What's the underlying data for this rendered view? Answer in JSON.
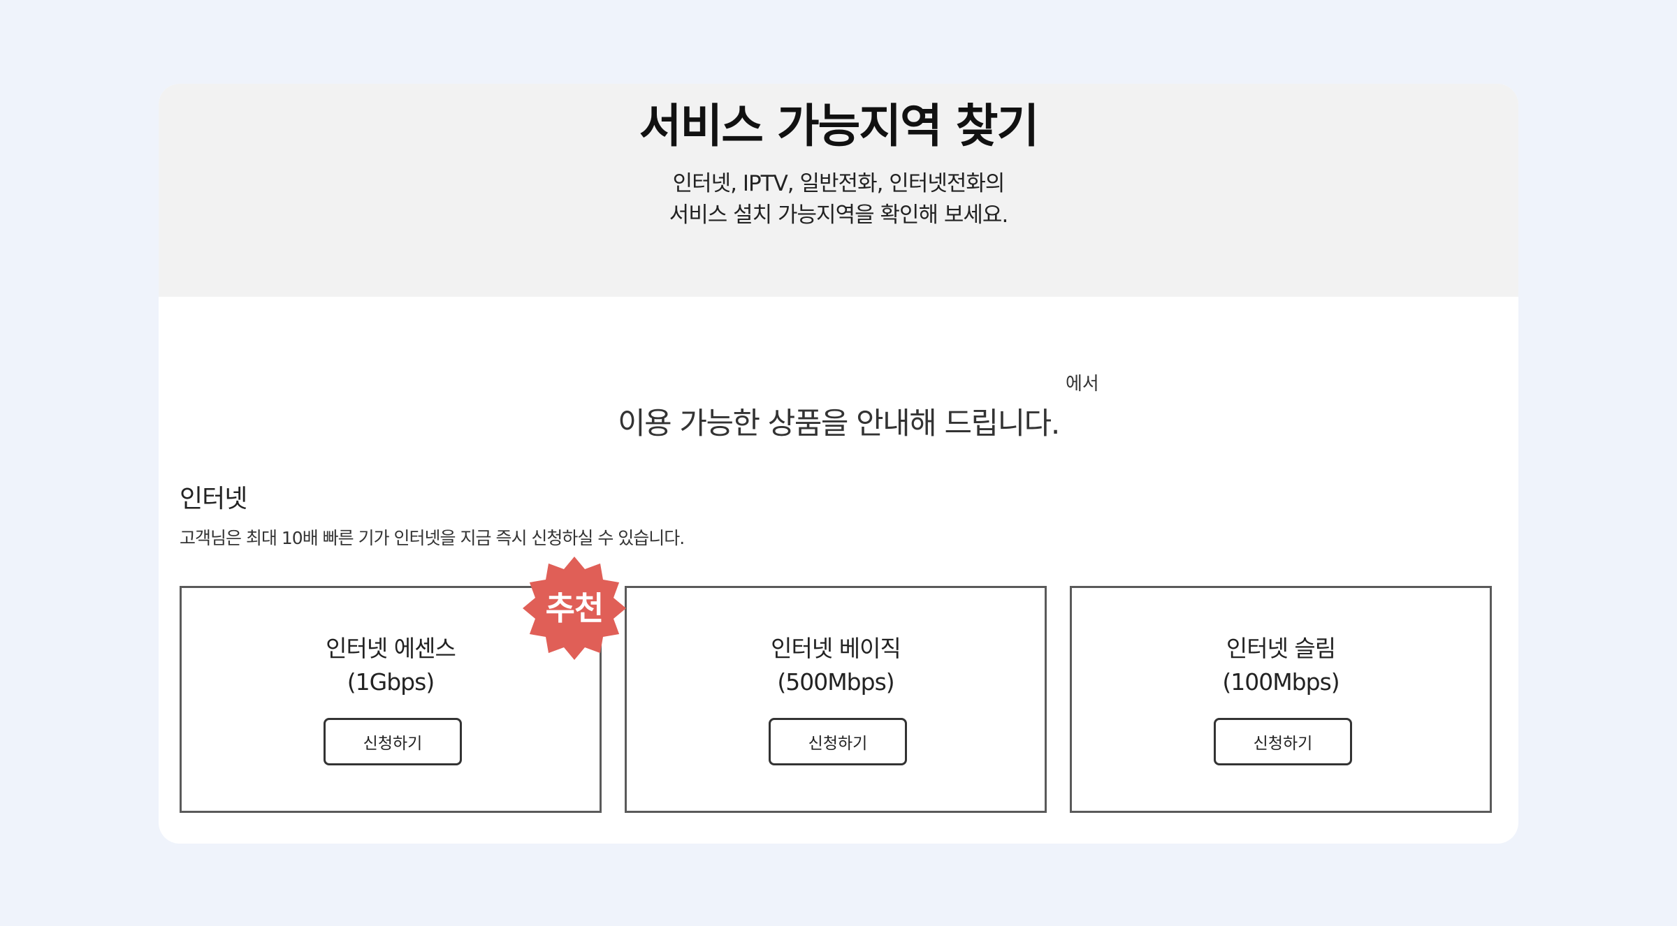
{
  "header": {
    "title": "서비스 가능지역 찾기",
    "subtitle_line1": "인터넷, IPTV, 일반전화, 인터넷전화의",
    "subtitle_line2": "서비스 설치 가능지역을 확인해 보세요."
  },
  "result": {
    "location_suffix": "에서",
    "heading": "이용 가능한 상품을 안내해 드립니다."
  },
  "internet_section": {
    "title": "인터넷",
    "description": "고객님은 최대 10배 빠른 기가 인터넷을 지금 즉시 신청하실 수 있습니다.",
    "badge_label": "추천",
    "badge_color": "#e05f57",
    "products": [
      {
        "name": "인터넷 에센스",
        "speed": "(1Gbps)",
        "button_label": "신청하기"
      },
      {
        "name": "인터넷 베이직",
        "speed": "(500Mbps)",
        "button_label": "신청하기"
      },
      {
        "name": "인터넷 슬림",
        "speed": "(100Mbps)",
        "button_label": "신청하기"
      }
    ]
  }
}
